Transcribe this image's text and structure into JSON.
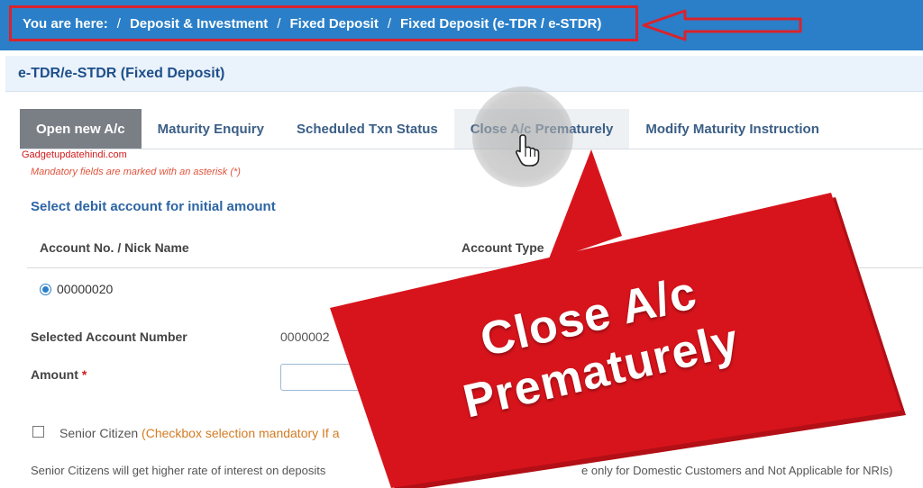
{
  "breadcrumb": {
    "lead": "You are here:",
    "items": [
      "Deposit & Investment",
      "Fixed Deposit",
      "Fixed Deposit (e-TDR / e-STDR)"
    ]
  },
  "page": {
    "title": "e-TDR/e-STDR (Fixed Deposit)"
  },
  "tabs": [
    {
      "label": "Open new A/c",
      "active": true
    },
    {
      "label": "Maturity Enquiry"
    },
    {
      "label": "Scheduled Txn Status"
    },
    {
      "label": "Close A/c Prematurely"
    },
    {
      "label": "Modify Maturity Instruction"
    }
  ],
  "watermark": "Gadgetupdatehindi.com",
  "form": {
    "mandatory_note": "Mandatory fields are marked with an asterisk (*)",
    "section_label": "Select debit account for initial amount",
    "columns": {
      "account": "Account No. / Nick Name",
      "type": "Account Type"
    },
    "account_value": "00000020",
    "selected_account_label": "Selected Account Number",
    "selected_account_value": "0000002",
    "amount_label": "Amount",
    "amount_required": "*",
    "senior_label": "Senior Citizen",
    "senior_note": "(Checkbox selection mandatory If a",
    "footer_left": "Senior Citizens will get higher rate of interest on deposits",
    "footer_right": "e only for Domestic Customers and Not Applicable for NRIs)"
  },
  "callout": {
    "line1": "Close A/c",
    "line2": "Prematurely"
  },
  "colors": {
    "topbar": "#2a7fc8",
    "highlight": "#d9232d",
    "callout": "#d7141c",
    "active_tab": "#7a7f86"
  },
  "icons": {
    "cursor": "hand-pointer-icon",
    "arrow": "left-arrow-icon"
  }
}
